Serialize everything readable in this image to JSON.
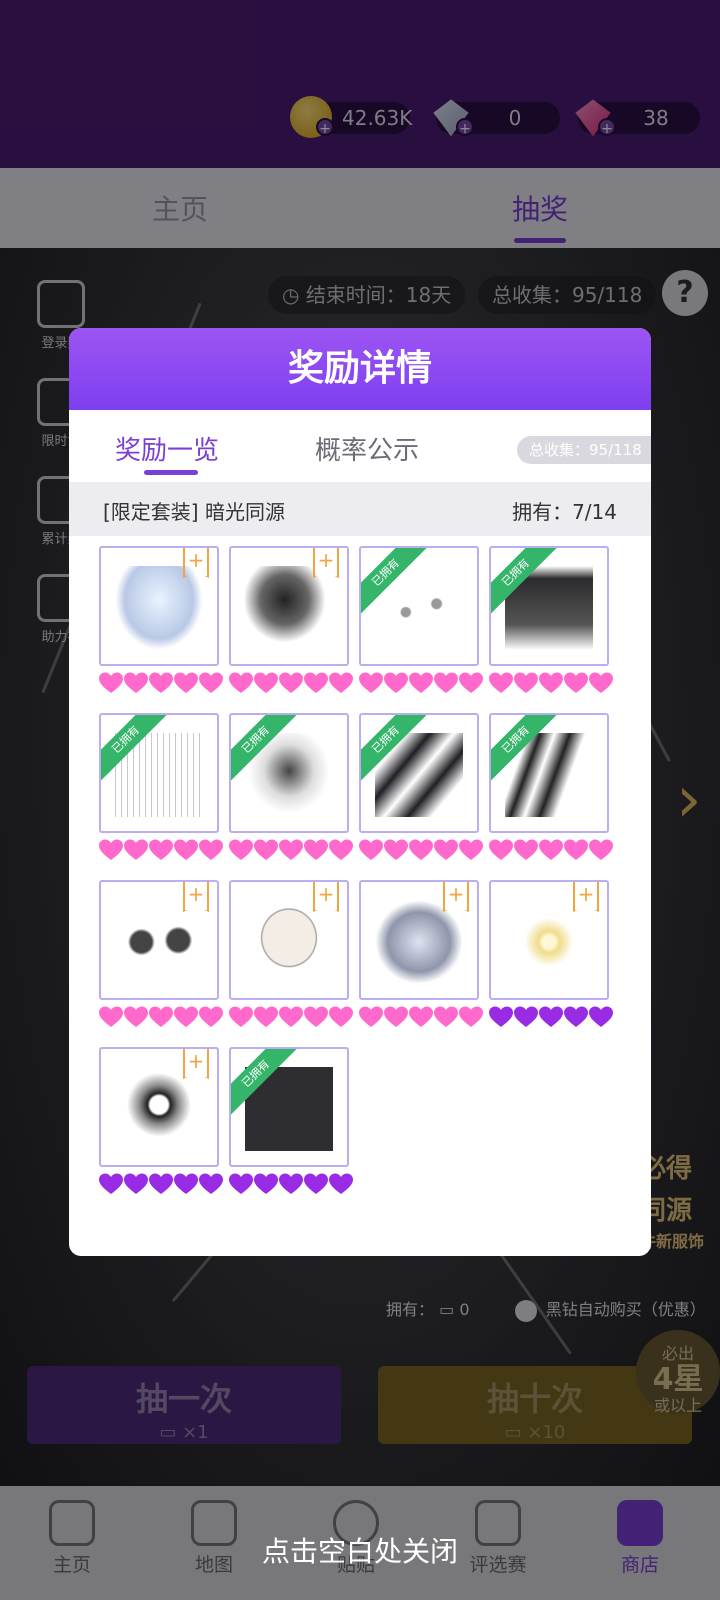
{
  "currency": {
    "gold": "42.63K",
    "diamond": "0",
    "ruby": "38"
  },
  "main_tabs": [
    "主页",
    "抽奖"
  ],
  "scene": {
    "end_time": "结束时间：18天",
    "collect": "总收集：95/118",
    "help": "?",
    "side": [
      "登录奖",
      "限时售",
      "累计奖",
      "助力礼"
    ],
    "own_label": "拥有：",
    "own_value": "0",
    "auto_buy": "黑钻自动购买（优惠）",
    "promo": [
      "必得",
      "同源",
      "件新服饰"
    ],
    "draw_one": {
      "label": "抽一次",
      "cost": "×1"
    },
    "draw_ten": {
      "label": "抽十次",
      "cost": "×10"
    },
    "badge": {
      "top": "必出",
      "big": "4星",
      "bottom": "或以上"
    }
  },
  "nav": [
    "主页",
    "地图",
    "贴贴",
    "评选赛",
    "商店"
  ],
  "close_hint": "点击空白处关闭",
  "modal": {
    "title": "奖励详情",
    "tab_rewards": "奖励一览",
    "tab_probability": "概率公示",
    "total": "总收集：95/118",
    "set_name": "[限定套装] 暗光同源",
    "set_owned": "拥有：7/14",
    "owned_tag": "已拥有",
    "plus_tag": "+",
    "items": [
      {
        "name": "hair",
        "owned": false,
        "stars": "pink"
      },
      {
        "name": "headpiece",
        "owned": false,
        "stars": "pink"
      },
      {
        "name": "earrings",
        "owned": true,
        "stars": "pink"
      },
      {
        "name": "dress",
        "owned": true,
        "stars": "pink"
      },
      {
        "name": "veil",
        "owned": true,
        "stars": "pink"
      },
      {
        "name": "necklace",
        "owned": true,
        "stars": "pink"
      },
      {
        "name": "shoes",
        "owned": true,
        "stars": "pink"
      },
      {
        "name": "gloves",
        "owned": true,
        "stars": "pink"
      },
      {
        "name": "hair-ornament",
        "owned": false,
        "stars": "pink"
      },
      {
        "name": "makeup",
        "owned": false,
        "stars": "pink"
      },
      {
        "name": "hair-alt",
        "owned": false,
        "stars": "pink"
      },
      {
        "name": "effect",
        "owned": false,
        "stars": "purple"
      },
      {
        "name": "background",
        "owned": false,
        "stars": "purple"
      },
      {
        "name": "frame",
        "owned": true,
        "stars": "purple"
      }
    ]
  },
  "colors": {
    "accent": "#7b3fd6",
    "owned_ribbon": "#35b56a",
    "heart_pink": "#ff69cc",
    "heart_purple": "#9a2be4"
  }
}
